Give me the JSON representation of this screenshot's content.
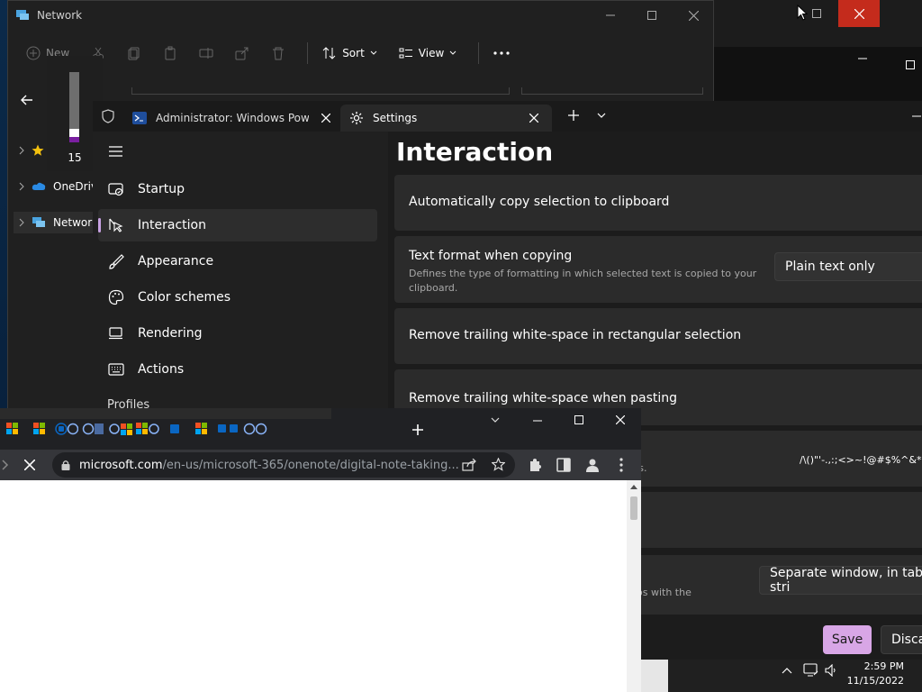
{
  "explorer": {
    "title": "Network",
    "cmd_new": "New",
    "cmd_sort": "Sort",
    "cmd_view": "View",
    "tree": [
      {
        "label": "",
        "icon": "star-icon"
      },
      {
        "label": "OneDrive",
        "icon": "onedrive-icon"
      },
      {
        "label": "Network",
        "icon": "network-icon"
      }
    ]
  },
  "volume": {
    "level": "15",
    "level_fraction": 0.15
  },
  "terminal": {
    "tabs": [
      {
        "label": "Administrator: Windows Power"
      },
      {
        "label": "Settings"
      }
    ],
    "sidebar": [
      {
        "label": "Startup",
        "icon": "startup-icon"
      },
      {
        "label": "Interaction",
        "icon": "interaction-icon"
      },
      {
        "label": "Appearance",
        "icon": "appearance-icon"
      },
      {
        "label": "Color schemes",
        "icon": "color-schemes-icon"
      },
      {
        "label": "Rendering",
        "icon": "rendering-icon"
      },
      {
        "label": "Actions",
        "icon": "actions-icon"
      }
    ],
    "profiles_heading": "Profiles",
    "page_title": "Interaction",
    "settings": {
      "copy_on_select": "Automatically copy selection to clipboard",
      "text_format_label": "Text format when copying",
      "text_format_desc_1": "Defines the type of formatting in which selected text is copied to your",
      "text_format_desc_2": "clipboard.",
      "text_format_value": "Plain text only",
      "trim_block": "Remove trailing white-space in rectangular selection",
      "trim_paste": "Remove trailing white-space when pasting",
      "word_delims_value": "/\\()\"'-.,:;<>~!@#$%^&*|",
      "word_delims_desc_tail": "rds.",
      "tear_out_desc_tail": "abs with the",
      "new_tab_desc_tail": ".",
      "tab_mode_value": "Separate window, in tab stri"
    },
    "save_label": "Save",
    "discard_label": "Discar"
  },
  "chrome": {
    "url_host": "microsoft.com",
    "url_path": "/en-us/microsoft-365/onenote/digital-note-taking..."
  },
  "taskbar": {
    "time": "2:59 PM",
    "date": "11/15/2022"
  },
  "colors": {
    "accent": "#d8a6e6",
    "window_bg": "#202020",
    "card_bg": "#2b2b2b"
  }
}
